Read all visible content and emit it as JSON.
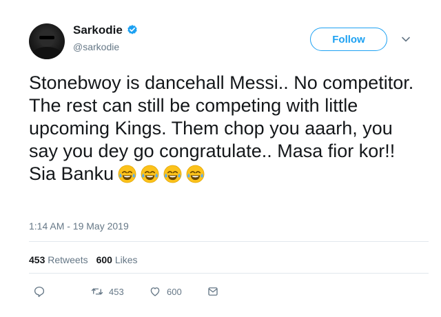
{
  "user": {
    "display_name": "Sarkodie",
    "handle": "@sarkodie",
    "verified": true
  },
  "follow_label": "Follow",
  "tweet": {
    "text": "Stonebwoy is dancehall Messi.. No competitor. The rest can still be competing with little upcoming Kings. Them chop you aaarh, you say you dey go congratulate.. Masa fior kor!! Sia Banku",
    "emojis": [
      "face-with-tears-of-joy",
      "face-with-tears-of-joy",
      "face-with-tears-of-joy",
      "face-with-tears-of-joy"
    ],
    "timestamp": "1:14 AM - 19 May 2019"
  },
  "stats": {
    "retweets_count": "453",
    "retweets_label": "Retweets",
    "likes_count": "600",
    "likes_label": "Likes"
  },
  "actions": {
    "reply_icon": "reply-icon",
    "retweet_icon": "retweet-icon",
    "retweet_count": "453",
    "like_icon": "heart-icon",
    "like_count": "600",
    "dm_icon": "envelope-icon"
  },
  "colors": {
    "accent": "#1da1f2",
    "text": "#14171a",
    "muted": "#657786",
    "divider": "#e1e8ed"
  }
}
